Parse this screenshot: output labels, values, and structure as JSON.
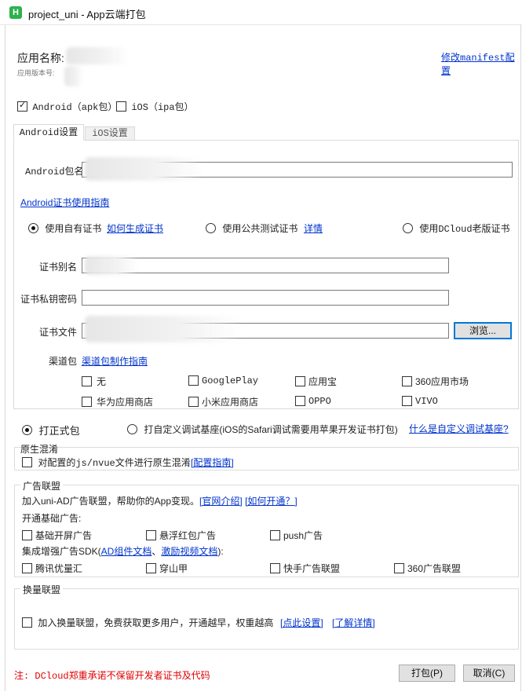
{
  "window": {
    "title": "project_uni - App云端打包",
    "icon": "H"
  },
  "app_info": {
    "name_label": "应用名称:",
    "version_label": "应用版本号:",
    "modify_manifest_link": "修改manifest配置"
  },
  "platforms": {
    "android_label": "Android（apk包）",
    "ios_label": "iOS（ipa包）",
    "android_checked": true,
    "ios_checked": false
  },
  "tabs": [
    {
      "label": "Android设置",
      "active": true
    },
    {
      "label": "iOS设置",
      "active": false
    }
  ],
  "android": {
    "package_label": "Android包名",
    "cert_guide_link": "Android证书使用指南",
    "cert_options": {
      "own_label": "使用自有证书",
      "how_to_generate_link": "如何生成证书",
      "public_test_label": "使用公共测试证书",
      "details_link": "详情",
      "dcloud_old_label": "使用DCloud老版证书"
    },
    "alias_label": "证书别名",
    "password_label": "证书私钥密码",
    "file_label": "证书文件",
    "browse_button": "浏览...",
    "channel_label": "渠道包",
    "channel_guide_link": "渠道包制作指南",
    "channels": [
      "无",
      "GooglePlay",
      "应用宝",
      "360应用市场",
      "华为应用商店",
      "小米应用商店",
      "OPPO",
      "VIVO"
    ]
  },
  "build_mode": {
    "formal_label": "打正式包",
    "custom_base_label": "打自定义调试基座(iOS的Safari调试需要用苹果开发证书打包)",
    "what_is_custom_link": "什么是自定义调试基座?"
  },
  "native_obfuscation": {
    "title": "原生混淆",
    "checkbox_label": "对配置的js/nvue文件进行原生混淆",
    "guide_link": "[配置指南]"
  },
  "ad_union": {
    "title": "广告联盟",
    "intro_text": "加入uni-AD广告联盟，帮助你的App变现。",
    "official_link": "[官网介绍]",
    "how_to_join_link": "[如何开通？]",
    "basic_title": "开通基础广告:",
    "basic_items": [
      "基础开屏广告",
      "悬浮红包广告",
      "push广告"
    ],
    "sdk_title_prefix": "集成增强广告SDK(",
    "sdk_doc_link": "AD组件文档",
    "sdk_sep": "、",
    "sdk_video_link": "激励视频文档",
    "sdk_title_suffix": "):",
    "sdk_items": [
      "腾讯优量汇",
      "穿山甲",
      "快手广告联盟",
      "360广告联盟"
    ]
  },
  "exchange_union": {
    "title": "换量联盟",
    "checkbox_label": "加入换量联盟，免费获取更多用户，开通越早，权重越高",
    "settings_link": "[点此设置]",
    "details_link": "[了解详情]"
  },
  "footer": {
    "notice": "注: DCloud郑重承诺不保留开发者证书及代码",
    "pack_button": "打包(P)",
    "cancel_button": "取消(C)"
  }
}
